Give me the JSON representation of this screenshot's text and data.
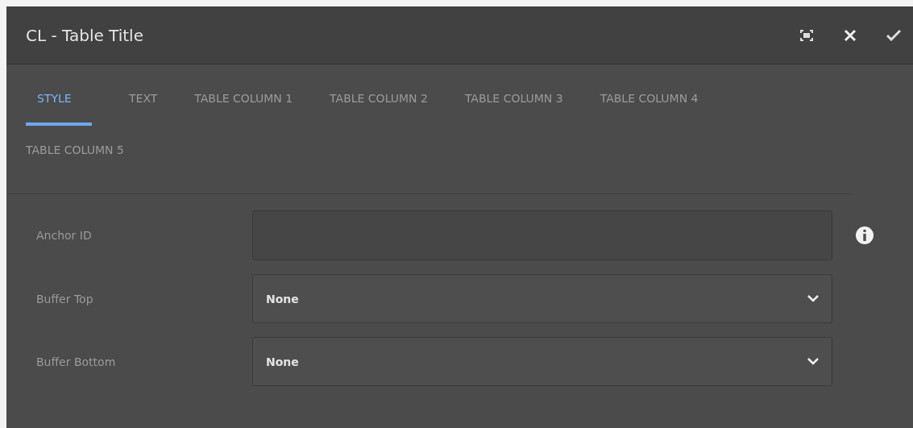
{
  "window": {
    "title": "CL - Table Title"
  },
  "tabs": [
    {
      "label": "STYLE",
      "selected": true
    },
    {
      "label": "TEXT",
      "selected": false
    },
    {
      "label": "TABLE COLUMN 1",
      "selected": false
    },
    {
      "label": "TABLE COLUMN 2",
      "selected": false
    },
    {
      "label": "TABLE COLUMN 3",
      "selected": false
    },
    {
      "label": "TABLE COLUMN 4",
      "selected": false
    },
    {
      "label": "TABLE COLUMN 5",
      "selected": false
    }
  ],
  "fields": [
    {
      "kind": "text",
      "label": "Anchor ID",
      "info": true
    },
    {
      "kind": "select",
      "label": "Buffer Top",
      "value": "None"
    },
    {
      "kind": "select",
      "label": "Buffer Bottom",
      "value": "None"
    }
  ]
}
